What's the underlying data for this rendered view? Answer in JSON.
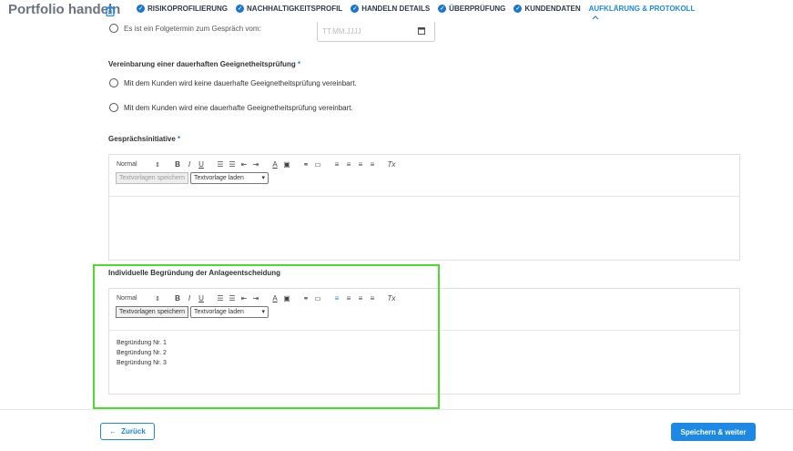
{
  "header": {
    "title": "Portfolio handeln",
    "steps": [
      {
        "label": "RISIKOPROFILIERUNG",
        "done": true
      },
      {
        "label": "NACHHALTIGKEITSPROFIL",
        "done": true
      },
      {
        "label": "HANDELN DETAILS",
        "done": true
      },
      {
        "label": "ÜBERPRÜFUNG",
        "done": true
      },
      {
        "label": "KUNDENDATEN",
        "done": true
      },
      {
        "label": "AUFKLÄRUNG & PROTOKOLL",
        "done": false,
        "active": true
      }
    ]
  },
  "followup": {
    "radio_label": "Es ist ein Folgetermin zum Gespräch vom:",
    "date_placeholder": "TT.MM.JJJJ"
  },
  "suitability": {
    "label": "Vereinbarung einer dauerhaften Geeignetheitsprüfung",
    "required_mark": "*",
    "options": [
      "Mit dem Kunden wird keine dauerhafte Geeignetheitsprüfung vereinbart.",
      "Mit dem Kunden wird eine dauerhafte Geeignetheitsprüfung vereinbart."
    ]
  },
  "toolbar": {
    "format": "Normal",
    "bold": "B",
    "italic": "I",
    "underline": "U",
    "clear": "Tx",
    "save_template": "Textvorlagen speichern",
    "load_template": "Textvorlage laden"
  },
  "initiative": {
    "label": "Gesprächsinitiative",
    "required_mark": "*"
  },
  "reason": {
    "label": "Individuelle Begründung der Anlageentscheidung",
    "lines": [
      "Begründung Nr. 1",
      "Begründung Nr. 2",
      "Begründung Nr. 3"
    ]
  },
  "footer": {
    "back_label": "Zurück",
    "next_label": "Speichern & weiter"
  },
  "colors": {
    "accent": "#1e88e5",
    "highlight": "#4cdd2c"
  }
}
